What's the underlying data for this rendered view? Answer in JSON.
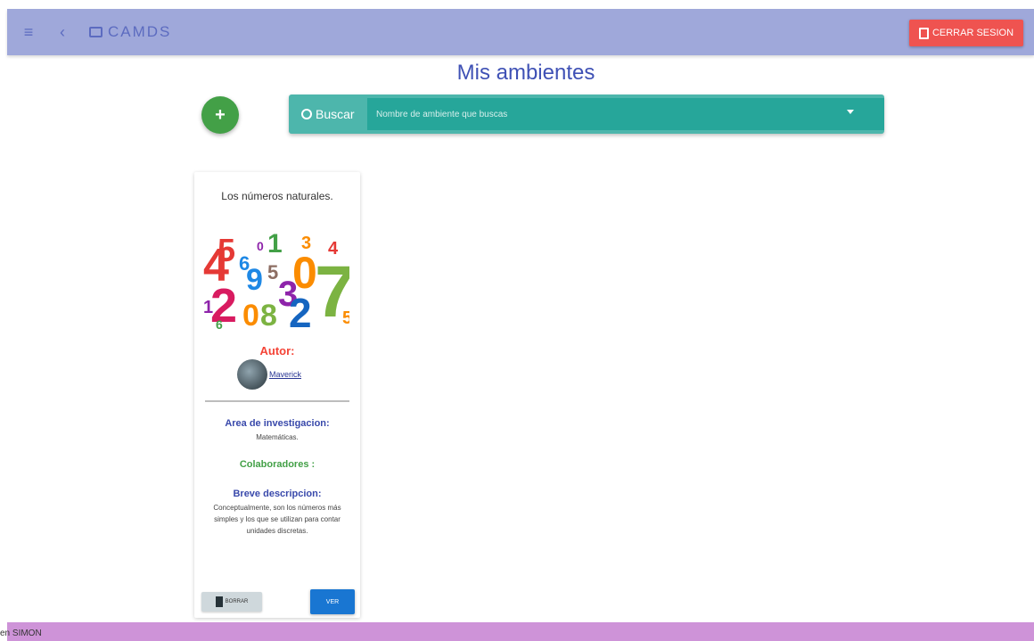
{
  "topbar": {
    "menu_icon": "menu-icon",
    "back_icon": "chevron-left-icon",
    "brand_icon": "window-icon",
    "brand": "CAMDS",
    "logout_icon": "logout-icon",
    "logout_label": "CERRAR SESION"
  },
  "page_title": "Mis ambientes",
  "add_button_label": "+",
  "search": {
    "label": "Buscar",
    "placeholder": "Nombre de ambiente que buscas"
  },
  "card": {
    "title": "Los números naturales.",
    "image_alt": "Colorful numbers",
    "author_heading": "Autor:",
    "author_name": "Maverick",
    "area_heading": "Area de investigacion:",
    "area_value": "Matemáticas.",
    "collab_heading": "Colaboradores :",
    "desc_heading": "Breve descripcion:",
    "desc_text": "Conceptualmente, son los números más simples y los que se utilizan para contar unidades discretas.",
    "delete_label": "BORRAR",
    "view_label": "VER"
  },
  "footer": {
    "text": "en SIMON"
  },
  "colors": {
    "topbar": "#9fa8da",
    "accent": "#3f51b5",
    "search": "#4db6ac",
    "danger": "#ef5350",
    "fab": "#43a047",
    "footer": "#ce93d8"
  }
}
